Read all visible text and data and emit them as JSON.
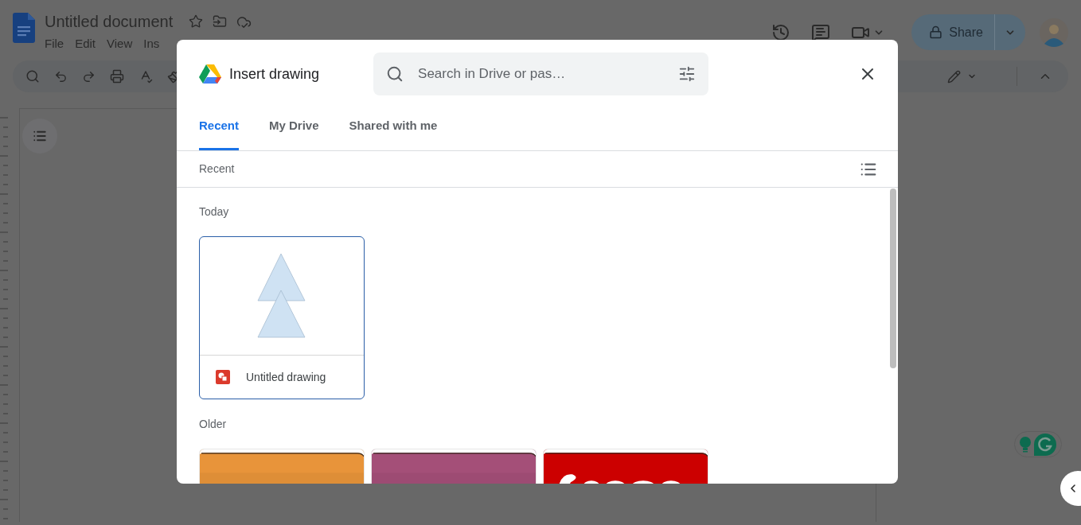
{
  "app": {
    "title": "Untitled document",
    "menus": [
      "File",
      "Edit",
      "View",
      "Ins"
    ],
    "share_button": "Share"
  },
  "dialog": {
    "title": "Insert drawing",
    "search": {
      "placeholder": "Search in Drive or pas…"
    },
    "tabs": [
      {
        "label": "Recent",
        "selected": true
      },
      {
        "label": "My Drive",
        "selected": false
      },
      {
        "label": "Shared with me",
        "selected": false
      }
    ],
    "location": "Recent",
    "sections": [
      {
        "heading": "Today",
        "files": [
          {
            "kind": "drawing",
            "name": "Untitled drawing",
            "selected": true
          }
        ]
      },
      {
        "heading": "Older"
      }
    ]
  }
}
